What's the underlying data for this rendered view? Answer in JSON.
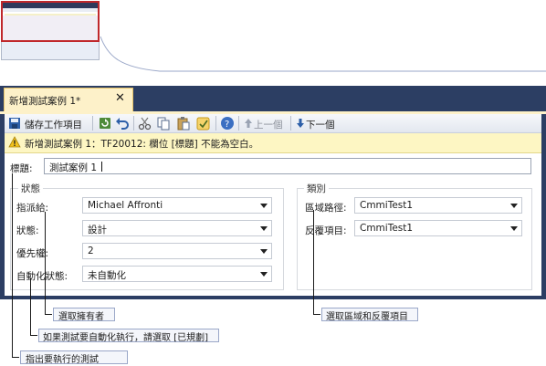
{
  "tab": {
    "title": "新增測試案例 1*",
    "close": "✕"
  },
  "toolbar": {
    "save": "儲存工作項目",
    "prev": "上一個",
    "next": "下一個"
  },
  "warning": {
    "text": "新增測試案例 1：TF20012: 欄位 [標題] 不能為空白。"
  },
  "form": {
    "title_label": "標題:",
    "title_value": "測試案例 1",
    "status": {
      "group_label": "狀態",
      "assigned_to_label": "指派給:",
      "assigned_to_value": "Michael Affronti",
      "state_label": "狀態:",
      "state_value": "設計",
      "priority_label": "優先權:",
      "priority_value": "2",
      "automation_label": "自動化狀態:",
      "automation_value": "未自動化"
    },
    "classification": {
      "group_label": "類別",
      "area_label": "區域路徑:",
      "area_value": "CmmiTest1",
      "iteration_label": "反覆項目:",
      "iteration_value": "CmmiTest1"
    }
  },
  "callouts": {
    "assignee": "選取擁有者",
    "automation": "如果測試要自動化執行，請選取 [已規劃]",
    "title": "指出要執行的測試",
    "area": "選取區域和反覆項目"
  },
  "colors": {
    "frame": "#2c3e63",
    "tab": "#fdf1c9",
    "warning_bg": "#fdf6c3",
    "thumb_border": "#c0282b"
  }
}
